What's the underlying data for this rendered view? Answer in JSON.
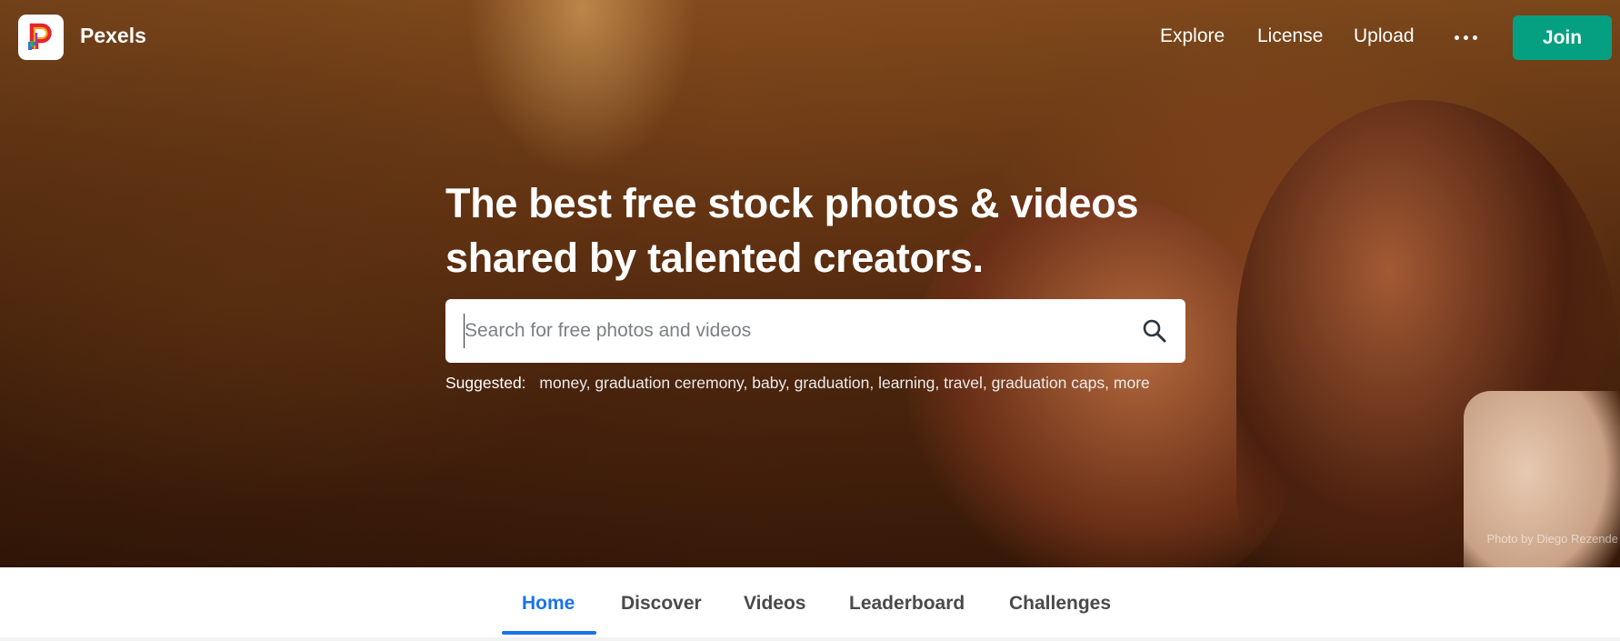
{
  "brand": {
    "name": "Pexels",
    "logo_icon": "pexels-logo-icon"
  },
  "nav": {
    "links": [
      "Explore",
      "License",
      "Upload"
    ],
    "more_icon": "more-horizontal-icon",
    "join_label": "Join"
  },
  "hero": {
    "headline_line1": "The best free stock photos & videos",
    "headline_line2": "shared by talented creators.",
    "search": {
      "placeholder": "Search for free photos and videos",
      "value": "",
      "icon": "search-icon"
    },
    "suggested_label": "Suggested:",
    "suggestions": [
      "money",
      "graduation ceremony",
      "baby",
      "graduation",
      "learning",
      "travel",
      "graduation caps",
      "more"
    ],
    "photo_credit": "Photo by Diego Rezende"
  },
  "tabs": [
    {
      "label": "Home",
      "active": true
    },
    {
      "label": "Discover",
      "active": false
    },
    {
      "label": "Videos",
      "active": false
    },
    {
      "label": "Leaderboard",
      "active": false
    },
    {
      "label": "Challenges",
      "active": false
    }
  ],
  "colors": {
    "accent": "#05a081",
    "tab_active": "#1a73e8"
  }
}
